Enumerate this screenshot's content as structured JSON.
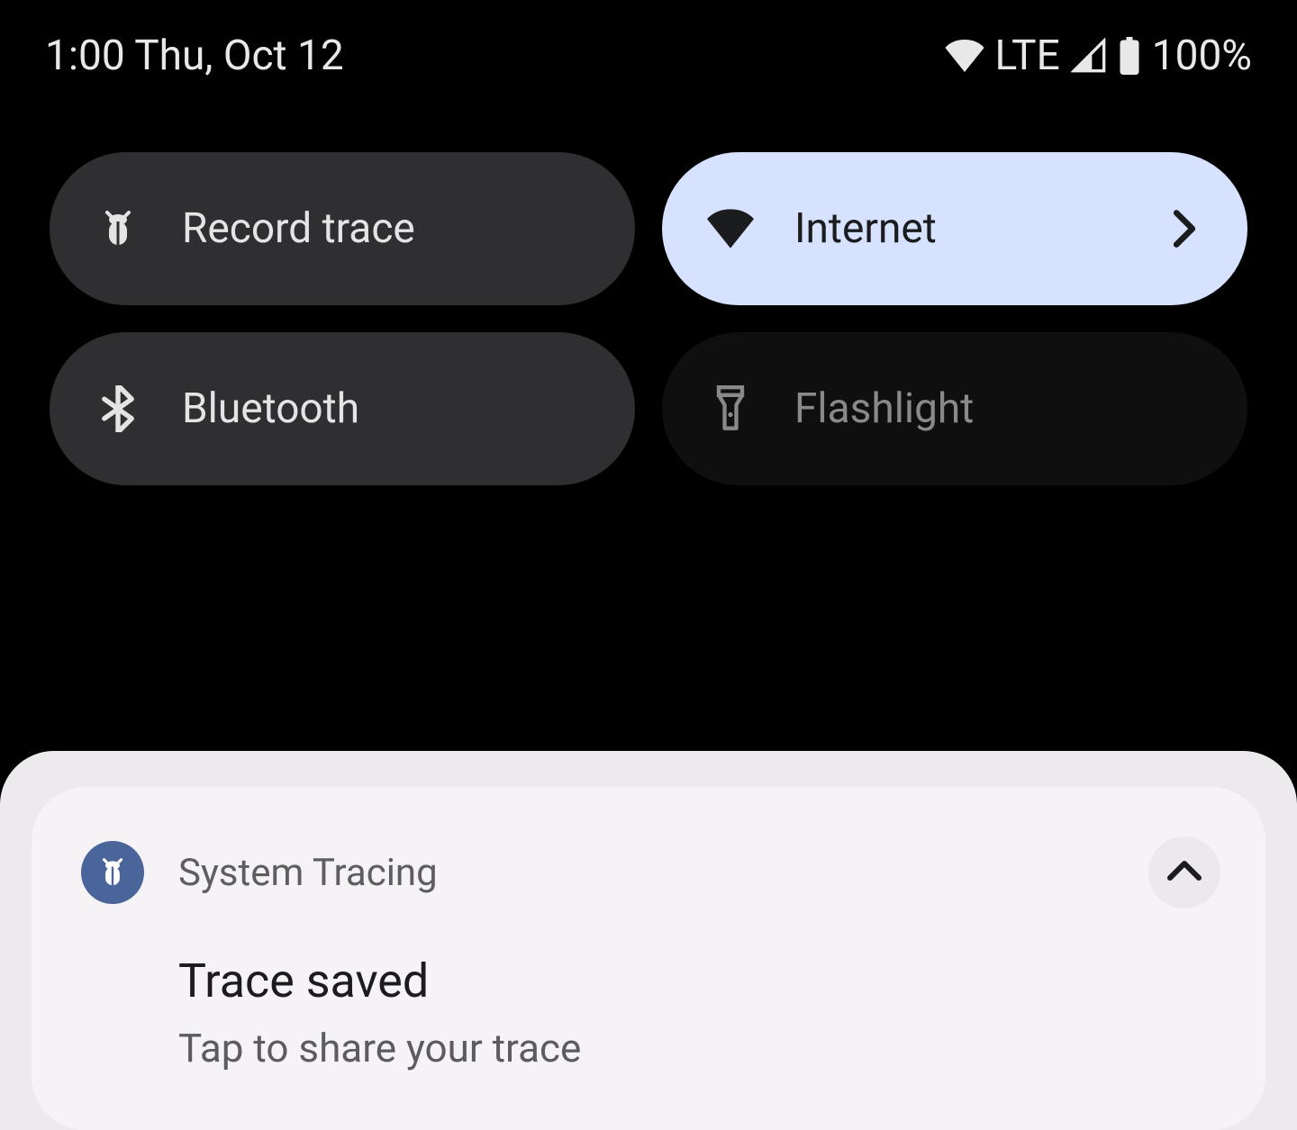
{
  "status_bar": {
    "time_date": "1:00 Thu, Oct 12",
    "network_label": "LTE",
    "battery_percent": "100%"
  },
  "tiles": [
    {
      "label": "Record trace",
      "state": "off",
      "icon": "bug-icon",
      "has_chevron": false
    },
    {
      "label": "Internet",
      "state": "on",
      "icon": "wifi-icon",
      "has_chevron": true
    },
    {
      "label": "Bluetooth",
      "state": "off",
      "icon": "bluetooth-icon",
      "has_chevron": false
    },
    {
      "label": "Flashlight",
      "state": "disabled",
      "icon": "flashlight-icon",
      "has_chevron": false
    }
  ],
  "notification": {
    "app_name": "System Tracing",
    "title": "Trace saved",
    "subtitle": "Tap to share your trace",
    "icon": "bug-icon"
  }
}
